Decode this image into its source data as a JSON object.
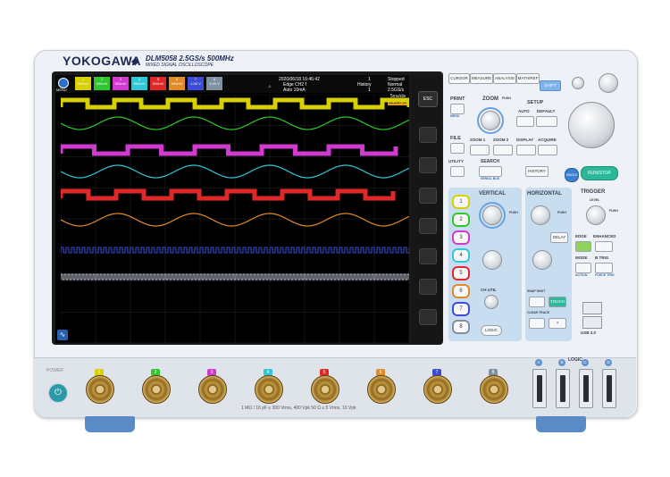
{
  "header": {
    "brand": "YOKOGAWA",
    "model": "DLM5058 2.5GS/s 500MHz",
    "model_sub": "MIXED SIGNAL OSCILLOSCOPE"
  },
  "screen": {
    "menu_label": "MENU",
    "channels": [
      {
        "num": "1",
        "scale": "500mV",
        "color": "#d8d000"
      },
      {
        "num": "2",
        "scale": "500mV",
        "color": "#2ec82e"
      },
      {
        "num": "3",
        "scale": "500mV",
        "color": "#d03ad0"
      },
      {
        "num": "4",
        "scale": "500mV",
        "color": "#2ec8d8"
      },
      {
        "num": "5",
        "scale": "500mV",
        "color": "#e02828"
      },
      {
        "num": "6",
        "scale": "500mV",
        "color": "#e08a28"
      },
      {
        "num": "7",
        "scale": "1.00 V",
        "color": "#3a4cd8"
      },
      {
        "num": "8",
        "scale": "1.00 V",
        "color": "#8090a0"
      }
    ],
    "datetime": "2020/06/18 16:46:42",
    "acq_count": "1",
    "status": "Stopped",
    "trigger_source": "Edge CH2 f",
    "history": "History",
    "history_mode": "Normal",
    "trigger_level": "Auto 10mA",
    "record_count": "1",
    "sample_rate": "2.5GS/s",
    "time_div": "5ms/div",
    "record_len": "125MPts"
  },
  "softkeys": {
    "esc": "ESC"
  },
  "panel": {
    "cursor": "CURSOR",
    "measure": "MEASURE",
    "analysis": "ANALYSIS",
    "math_ref": "MATH/REF",
    "shift": "SHIFT",
    "print": "PRINT",
    "menu": "MENU",
    "zoom": "ZOOM",
    "push_zoom": "PUSH",
    "setup": "SETUP",
    "auto": "AUTO",
    "default": "DEFAULT",
    "file": "FILE",
    "zoom1": "ZOOM 1",
    "zoom2": "ZOOM 2",
    "display": "DISPLAY",
    "acquire": "ACQUIRE",
    "utility": "UTILITY",
    "search": "SEARCH",
    "serial_bus": "SERIAL BUS",
    "history": "HISTORY",
    "single": "SINGLE",
    "run_stop": "RUN/STOP",
    "vertical": "VERTICAL",
    "horizontal": "HORIZONTAL",
    "trigger": "TRIGGER",
    "level": "LEVEL",
    "position": "POSITION",
    "push": "PUSH",
    "delay": "DELAY",
    "edge": "EDGE",
    "enhanced": "ENHANCED",
    "mode": "MODE",
    "btrig": "B TRIG",
    "action": "ACTION",
    "force_trig": "FORCE TRIG",
    "ch_util": "CH UTIL",
    "snap_shot": "SNAP SHOT",
    "touch": "TOUCH",
    "clear_trace": "CLEAR TRACE",
    "question": "?",
    "logic": "LOGIC",
    "usb": "USB 2.0",
    "ch_buttons": [
      "1",
      "2",
      "3",
      "4",
      "5",
      "6",
      "7",
      "8"
    ]
  },
  "front": {
    "power": "POWER",
    "spec": "1 MΩ / 16 pF ≤ 300 Vrms, 400 Vpk    50 Ω ≤ 5 Vrms, 10 Vpk",
    "logic_label": "LOGIC",
    "logic_ports": [
      "A",
      "B",
      "C",
      "D"
    ],
    "inputs": [
      "1",
      "2",
      "3",
      "4",
      "5",
      "6",
      "7",
      "8"
    ]
  }
}
